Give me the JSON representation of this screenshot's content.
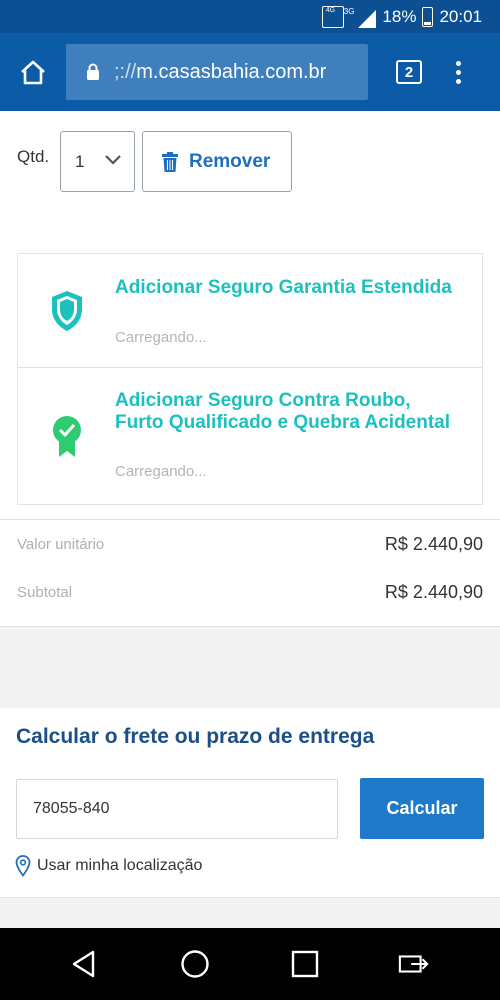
{
  "status_bar": {
    "network_tag_1": "4G",
    "network_tag_2": "3G",
    "battery": "18%",
    "time": "20:01"
  },
  "browser": {
    "url": "m.casasbahia.com.br",
    "url_prefix": ";://",
    "tab_count": "2"
  },
  "product": {
    "qty_label": "Qtd.",
    "qty_value": "1",
    "remove_label": "Remover",
    "insurances": [
      {
        "title": "Adicionar Seguro Garantia Estendida",
        "status": "Carregando...",
        "icon": "shield-icon"
      },
      {
        "title": "Adicionar Seguro Contra Roubo, Furto Qualificado e Quebra Acidental",
        "status": "Carregando...",
        "icon": "badge-check-icon"
      }
    ],
    "unit_price_label": "Valor unitário",
    "unit_price": "R$ 2.440,90",
    "subtotal_label": "Subtotal",
    "subtotal": "R$ 2.440,90"
  },
  "freight": {
    "title": "Calcular o frete ou prazo de entrega",
    "cep_value": "78055-840",
    "calc_button": "Calcular",
    "location_link": "Usar minha localização"
  },
  "colors": {
    "brand_dark": "#0c4f93",
    "toolbar": "#0c5ba6",
    "accent_blue": "#1e79c8",
    "teal": "#1cc1bf",
    "green": "#2ecc71"
  }
}
